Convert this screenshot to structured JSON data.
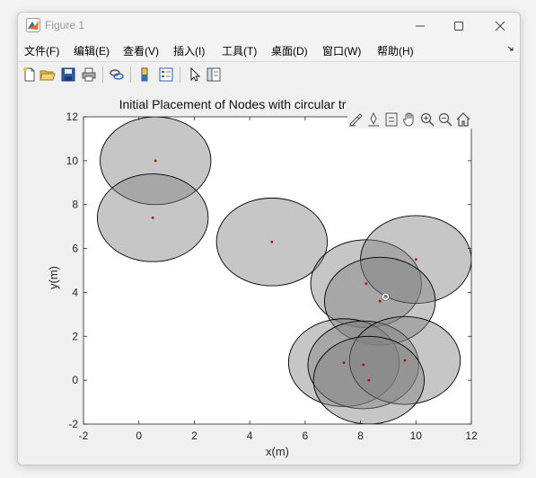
{
  "window": {
    "title": "Figure 1",
    "icons": [
      "matlab-logo-icon",
      "minimize-icon",
      "maximize-icon",
      "close-icon"
    ]
  },
  "menu": {
    "items": [
      "文件(F)",
      "编辑(E)",
      "查看(V)",
      "插入(I)",
      "工具(T)",
      "桌面(D)",
      "窗口(W)",
      "帮助(H)"
    ],
    "overflow_icon": "chevron-right-icon"
  },
  "toolbar": {
    "buttons": [
      "new-figure-icon",
      "open-file-icon",
      "save-icon",
      "print-icon",
      "link-plot-icon",
      "colorbar-icon",
      "legend-icon",
      "pointer-icon",
      "property-editor-icon"
    ]
  },
  "axes_toolbar": {
    "buttons": [
      "edit-brush-icon",
      "data-tip-icon",
      "restore-view-icon",
      "pan-hand-icon",
      "zoom-in-icon",
      "zoom-out-icon",
      "home-icon"
    ]
  },
  "colors": {
    "circle_fill": "#808080",
    "circle_stroke": "#000000",
    "node_marker": "#cc0000",
    "highlight_marker": "#ffffff"
  },
  "chart_data": {
    "type": "scatter",
    "title": "Initial Placement of Nodes with circular tr",
    "xlabel": "x(m)",
    "ylabel": "y(m)",
    "xlim": [
      -2,
      12
    ],
    "ylim": [
      -2,
      12
    ],
    "xticks": [
      "-2",
      "0",
      "2",
      "4",
      "6",
      "8",
      "10",
      "12"
    ],
    "yticks": [
      "-2",
      "0",
      "2",
      "4",
      "6",
      "8",
      "10",
      "12"
    ],
    "circle_radius": 2,
    "grid": false,
    "nodes": [
      {
        "x": 0.6,
        "y": 10.0
      },
      {
        "x": 0.5,
        "y": 7.4
      },
      {
        "x": 4.8,
        "y": 6.3
      },
      {
        "x": 8.2,
        "y": 4.4
      },
      {
        "x": 10.0,
        "y": 5.5
      },
      {
        "x": 8.7,
        "y": 3.6
      },
      {
        "x": 7.4,
        "y": 0.8
      },
      {
        "x": 8.1,
        "y": 0.7
      },
      {
        "x": 9.6,
        "y": 0.9
      },
      {
        "x": 8.3,
        "y": 0.0
      }
    ],
    "highlight_point": {
      "x": 8.9,
      "y": 3.8
    }
  }
}
